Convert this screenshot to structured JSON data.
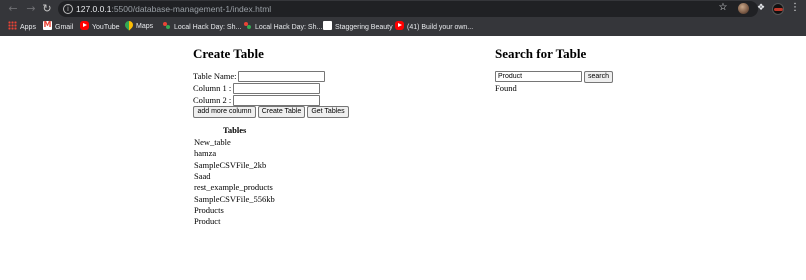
{
  "browser": {
    "url_host": "127.0.0.1",
    "url_path": ":5500/database-management-1/index.html",
    "bookmarks": [
      {
        "label": "Apps",
        "icon": "apps-grid-icon"
      },
      {
        "label": "Gmail",
        "icon": "gmail-icon"
      },
      {
        "label": "YouTube",
        "icon": "youtube-icon"
      },
      {
        "label": "Maps",
        "icon": "maps-icon"
      },
      {
        "label": "Local Hack Day: Sh...",
        "icon": "hackday-icon"
      },
      {
        "label": "Local Hack Day: Sh...",
        "icon": "hackday-icon"
      },
      {
        "label": "Staggering Beauty",
        "icon": "page-icon"
      },
      {
        "label": "(41) Build your own...",
        "icon": "youtube-icon"
      }
    ]
  },
  "create": {
    "heading": "Create Table",
    "table_name_label": "Table Name:",
    "table_name_value": "",
    "column1_label": "Column 1 :",
    "column1_value": "",
    "column2_label": "Column 2 :",
    "column2_value": "",
    "add_column_button": "add more column",
    "create_button": "Create Table",
    "get_tables_button": "Get Tables"
  },
  "tables": {
    "header": "Tables",
    "rows": [
      "New_table",
      "hamza",
      "SampleCSVFile_2kb",
      "Saad",
      "rest_example_products",
      "SampleCSVFile_556kb",
      "Products",
      "Product"
    ]
  },
  "search": {
    "heading": "Search for Table",
    "input_value": "Product",
    "search_button": "search",
    "result": "Found"
  }
}
